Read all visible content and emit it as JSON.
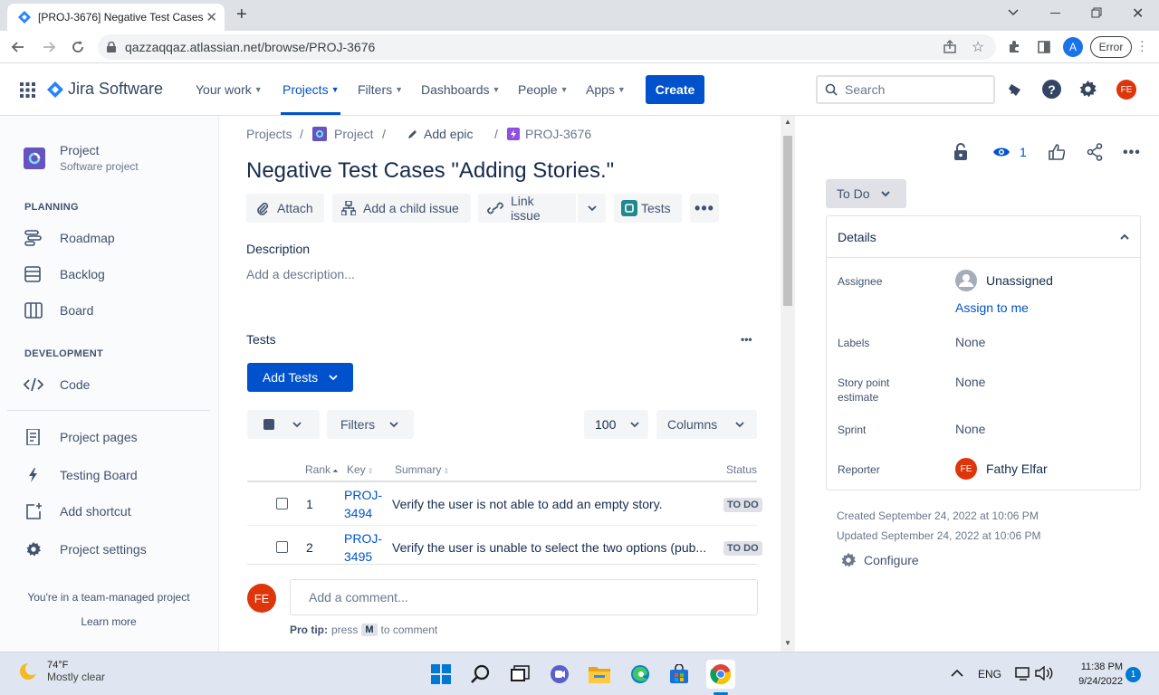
{
  "browser": {
    "tab_title": "[PROJ-3676] Negative Test Cases",
    "url": "qazzaqqaz.atlassian.net/browse/PROJ-3676",
    "profile_letter": "A",
    "error_label": "Error"
  },
  "jira_nav": {
    "logo_text": "Jira Software",
    "items": [
      "Your work",
      "Projects",
      "Filters",
      "Dashboards",
      "People",
      "Apps"
    ],
    "create_label": "Create",
    "search_placeholder": "Search",
    "avatar_initials": "FE"
  },
  "sidebar": {
    "project_name": "Project",
    "project_type": "Software project",
    "planning_heading": "PLANNING",
    "planning_items": [
      "Roadmap",
      "Backlog",
      "Board"
    ],
    "development_heading": "DEVELOPMENT",
    "development_items": [
      "Code"
    ],
    "other_items": [
      "Project pages",
      "Testing Board",
      "Add shortcut",
      "Project settings"
    ],
    "team_note": "You're in a team-managed project",
    "learn_more": "Learn more"
  },
  "issue": {
    "breadcrumb": [
      "Projects",
      "Project",
      "Add epic",
      "PROJ-3676"
    ],
    "title": "Negative Test Cases \"Adding Stories.\"",
    "toolbar": [
      "Attach",
      "Add a child issue",
      "Link issue",
      "Tests"
    ],
    "description_heading": "Description",
    "description_placeholder": "Add a description...",
    "tests_heading": "Tests",
    "add_tests_label": "Add Tests",
    "filters_label": "Filters",
    "page_size": "100",
    "columns_label": "Columns",
    "table_headers": [
      "Rank",
      "Key",
      "Summary",
      "Status"
    ],
    "rows": [
      {
        "rank": "1",
        "key_a": "PROJ-",
        "key_b": "3494",
        "summary": "Verify the user is not able to add an empty story.",
        "status": "TO DO"
      },
      {
        "rank": "2",
        "key_a": "PROJ-",
        "key_b": "3495",
        "summary": "Verify the user is unable to select the two options (pub...",
        "status": "TO DO"
      }
    ],
    "comment_avatar": "FE",
    "comment_placeholder": "Add a comment...",
    "pro_tip_label": "Pro tip:",
    "pro_tip_press": "press",
    "pro_tip_key": "M",
    "pro_tip_suffix": "to comment"
  },
  "details_panel": {
    "watch_count": "1",
    "status": "To Do",
    "heading": "Details",
    "assignee_label": "Assignee",
    "assignee_value": "Unassigned",
    "assign_to_me": "Assign to me",
    "labels_label": "Labels",
    "labels_value": "None",
    "story_points_label_a": "Story point",
    "story_points_label_b": "estimate",
    "story_points_value": "None",
    "sprint_label": "Sprint",
    "sprint_value": "None",
    "reporter_label": "Reporter",
    "reporter_initials": "FE",
    "reporter_value": "Fathy Elfar",
    "created": "Created September 24, 2022 at 10:06 PM",
    "updated": "Updated September 24, 2022 at 10:06 PM",
    "configure": "Configure"
  },
  "taskbar": {
    "temperature": "74°F",
    "weather": "Mostly clear",
    "language": "ENG",
    "time": "11:38 PM",
    "date": "9/24/2022",
    "notification_count": "1"
  }
}
